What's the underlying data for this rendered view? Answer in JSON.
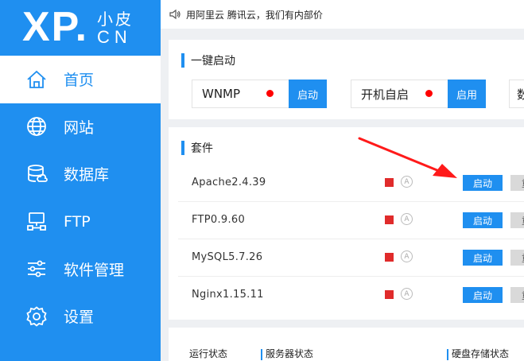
{
  "logo": {
    "xp": "XP.",
    "name": "小皮",
    "cn": "CN"
  },
  "nav": [
    {
      "label": "首页",
      "icon": "home-icon"
    },
    {
      "label": "网站",
      "icon": "globe-icon"
    },
    {
      "label": "数据库",
      "icon": "database-icon"
    },
    {
      "label": "FTP",
      "icon": "ftp-icon"
    },
    {
      "label": "软件管理",
      "icon": "sliders-icon"
    },
    {
      "label": "设置",
      "icon": "gear-icon"
    }
  ],
  "topbar": {
    "notice": "用阿里云 腾讯云，我们有内部价",
    "icon": "speaker-icon"
  },
  "quick": {
    "title": "一键启动",
    "wnmp_label": "WNMP",
    "wnmp_btn": "启动",
    "boot_label": "开机自启",
    "boot_btn": "启用",
    "third_label": "数"
  },
  "suite": {
    "title": "套件",
    "rows": [
      {
        "name": "Apache2.4.39",
        "start": "启动",
        "more": "重"
      },
      {
        "name": "FTP0.9.60",
        "start": "启动",
        "more": "重"
      },
      {
        "name": "MySQL5.7.26",
        "start": "启动",
        "more": "重"
      },
      {
        "name": "Nginx1.15.11",
        "start": "启动",
        "more": "重"
      }
    ],
    "auto_glyph": "A"
  },
  "bottom": {
    "tab1": "运行状态",
    "tab2": "服务器状态",
    "tab3": "硬盘存储状态"
  },
  "colors": {
    "accent": "#1f8ff0",
    "status_red": "#e02b2b",
    "arrow": "#ff1a1a"
  }
}
